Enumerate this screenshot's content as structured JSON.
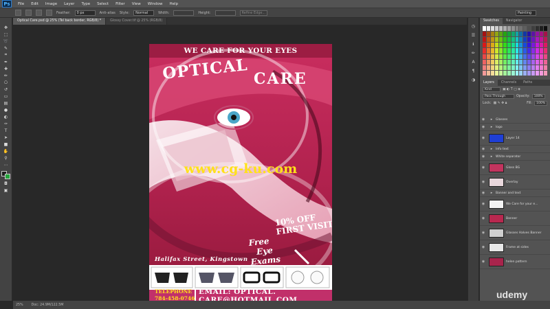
{
  "app": {
    "logo": "Ps"
  },
  "menu": [
    "File",
    "Edit",
    "Image",
    "Layer",
    "Type",
    "Select",
    "Filter",
    "View",
    "Window",
    "Help"
  ],
  "options": {
    "feather_label": "Feather:",
    "feather_value": "0 px",
    "antialias_label": "Anti-alias",
    "style_label": "Style:",
    "style_value": "Normal",
    "width_label": "Width:",
    "height_label": "Height:",
    "refine_label": "Refine Edge...",
    "workspace": "Painting"
  },
  "tabs": [
    "Optical Care.psd @ 25% (Tel back border, RGB/8) *",
    "Glossy Cover.tif @ 25% (RGB/8)"
  ],
  "poster": {
    "tagline": "WE CARE FOR YOUR EYES",
    "title_left": "OPTICAL",
    "title_right": "CARE",
    "watermark": "www.cg-ku.com",
    "offer": [
      "10% OFF",
      "FIRST VISIT"
    ],
    "free": [
      "Free",
      "Eye",
      "Exams"
    ],
    "address": "Halifax Street, Kingstown",
    "telephone_label": "TELEPHONE",
    "telephone_number": "784-458-0746",
    "email": [
      "EMAIL: OPTICAL.",
      "CARE@HOTMAIL.COM"
    ]
  },
  "panels": {
    "tabs": [
      "Swatches",
      "Navigator"
    ],
    "layers_tabs": [
      "Layers",
      "Channels",
      "Paths"
    ],
    "kind_label": "Kind",
    "blend_mode": "Pass Through",
    "opacity_label": "Opacity:",
    "opacity_value": "100%",
    "lock_label": "Lock:",
    "fill_label": "Fill:",
    "fill_value": "100%",
    "layers": [
      {
        "name": "Glasses",
        "type": "folder",
        "thumb": ""
      },
      {
        "name": "logo",
        "type": "folder",
        "thumb": ""
      },
      {
        "name": "Layer 14",
        "type": "layer",
        "thumb": "#1f3fd6"
      },
      {
        "name": "Info text",
        "type": "folder",
        "thumb": ""
      },
      {
        "name": "White separator",
        "type": "folder",
        "thumb": ""
      },
      {
        "name": "Gloss BG",
        "type": "layer",
        "thumb": "#c2345e"
      },
      {
        "name": "Overlay",
        "type": "layer",
        "thumb": "#e9d7dc"
      },
      {
        "name": "Banner and text",
        "type": "folder",
        "thumb": ""
      },
      {
        "name": "We Care for your e...",
        "type": "layer",
        "thumb": "#f3f3f3"
      },
      {
        "name": "Banner",
        "type": "layer",
        "thumb": "#b8284f"
      },
      {
        "name": "Glasses Halves Banner",
        "type": "layer",
        "thumb": "#cfcfcf"
      },
      {
        "name": "Frame at sides",
        "type": "layer",
        "thumb": "#e8e8e8"
      },
      {
        "name": "helen pattern",
        "type": "layer",
        "thumb": "#a8244c"
      }
    ]
  },
  "status": {
    "zoom": "25%",
    "doc": "Doc: 24.9M/122.5M"
  },
  "brand_watermark": "udemy"
}
